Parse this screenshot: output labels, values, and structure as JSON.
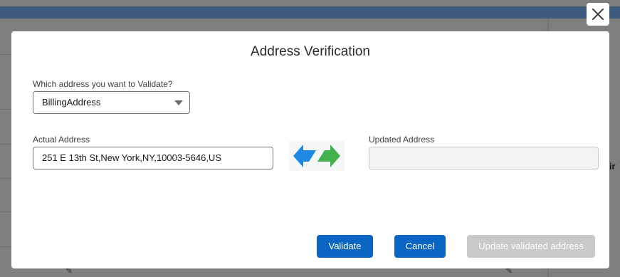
{
  "modal": {
    "title": "Address Verification",
    "select_label": "Which address you want to Validate?",
    "select_value": "BillingAddress",
    "actual_label": "Actual Address",
    "actual_value": "251 E 13th St,New York,NY,10003-5646,US",
    "updated_label": "Updated Address",
    "updated_value": "",
    "buttons": {
      "validate": "Validate",
      "cancel": "Cancel",
      "update": "Update validated address"
    }
  },
  "background": {
    "right_text": "nir"
  },
  "colors": {
    "brand": "#0a66c2",
    "arrow_blue": "#1e88e5",
    "arrow_green": "#43b14b",
    "disabled": "#c9c9c9"
  },
  "icons": {
    "close": "close-icon",
    "select_arrow": "chevron-down-icon",
    "swap": "swap-arrows-icon",
    "edit": "pencil-icon"
  }
}
